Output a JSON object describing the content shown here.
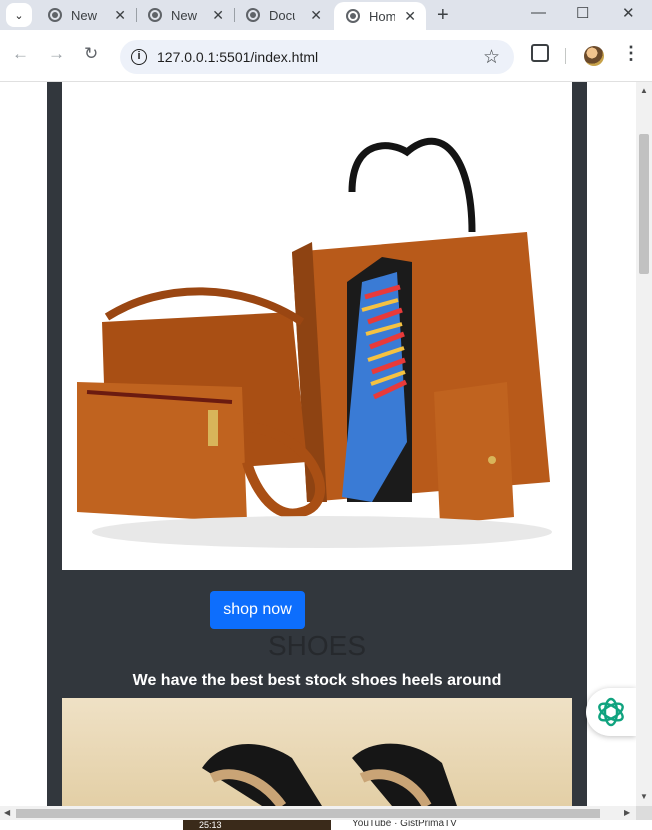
{
  "browser": {
    "tabs": [
      {
        "title": "New"
      },
      {
        "title": "New"
      },
      {
        "title": "Docu"
      },
      {
        "title": "Hom"
      }
    ],
    "url": "127.0.0.1:5501/index.html"
  },
  "page": {
    "shop_button": "shop now",
    "section_title": "SHOES",
    "section_subtitle": "We have the best best stock shoes heels around"
  },
  "bottom_peek": {
    "video_time": "25:13",
    "text": "YouTube · GistPrimaTV"
  }
}
